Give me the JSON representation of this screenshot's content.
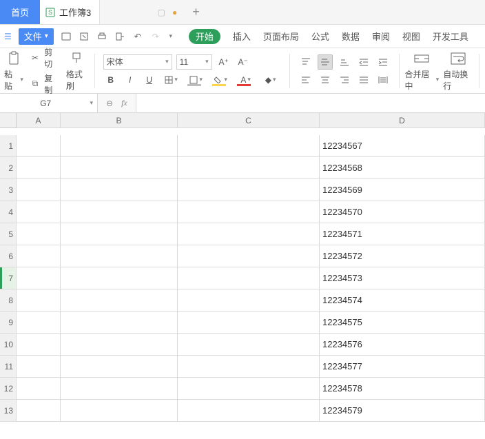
{
  "titlebar": {
    "home_tab": "首页",
    "doc_tab": "工作簿3",
    "modified_dot": "●",
    "new_tab_plus": "+"
  },
  "quickbar": {
    "file_menu": "文件",
    "ribbon_tabs": {
      "start": "开始",
      "insert": "插入",
      "page_layout": "页面布局",
      "formulas": "公式",
      "data": "数据",
      "review": "审阅",
      "view": "视图",
      "dev": "开发工具"
    }
  },
  "ribbon": {
    "paste_label": "粘贴",
    "cut_label": "剪切",
    "copy_label": "复制",
    "format_painter_label": "格式刷",
    "font_name": "宋体",
    "font_size": "11",
    "merge_center_label": "合并居中",
    "wrap_label": "自动换行"
  },
  "formula_bar": {
    "name_box": "G7",
    "fx": "fx",
    "formula": ""
  },
  "grid": {
    "columns": [
      "A",
      "B",
      "C",
      "D"
    ],
    "active_row": 7,
    "rows": [
      {
        "n": 1,
        "D": "12234567"
      },
      {
        "n": 2,
        "D": "12234568"
      },
      {
        "n": 3,
        "D": "12234569"
      },
      {
        "n": 4,
        "D": "12234570"
      },
      {
        "n": 5,
        "D": "12234571"
      },
      {
        "n": 6,
        "D": "12234572"
      },
      {
        "n": 7,
        "D": "12234573"
      },
      {
        "n": 8,
        "D": "12234574"
      },
      {
        "n": 9,
        "D": "12234575"
      },
      {
        "n": 10,
        "D": "12234576"
      },
      {
        "n": 11,
        "D": "12234577"
      },
      {
        "n": 12,
        "D": "12234578"
      },
      {
        "n": 13,
        "D": "12234579"
      }
    ]
  }
}
